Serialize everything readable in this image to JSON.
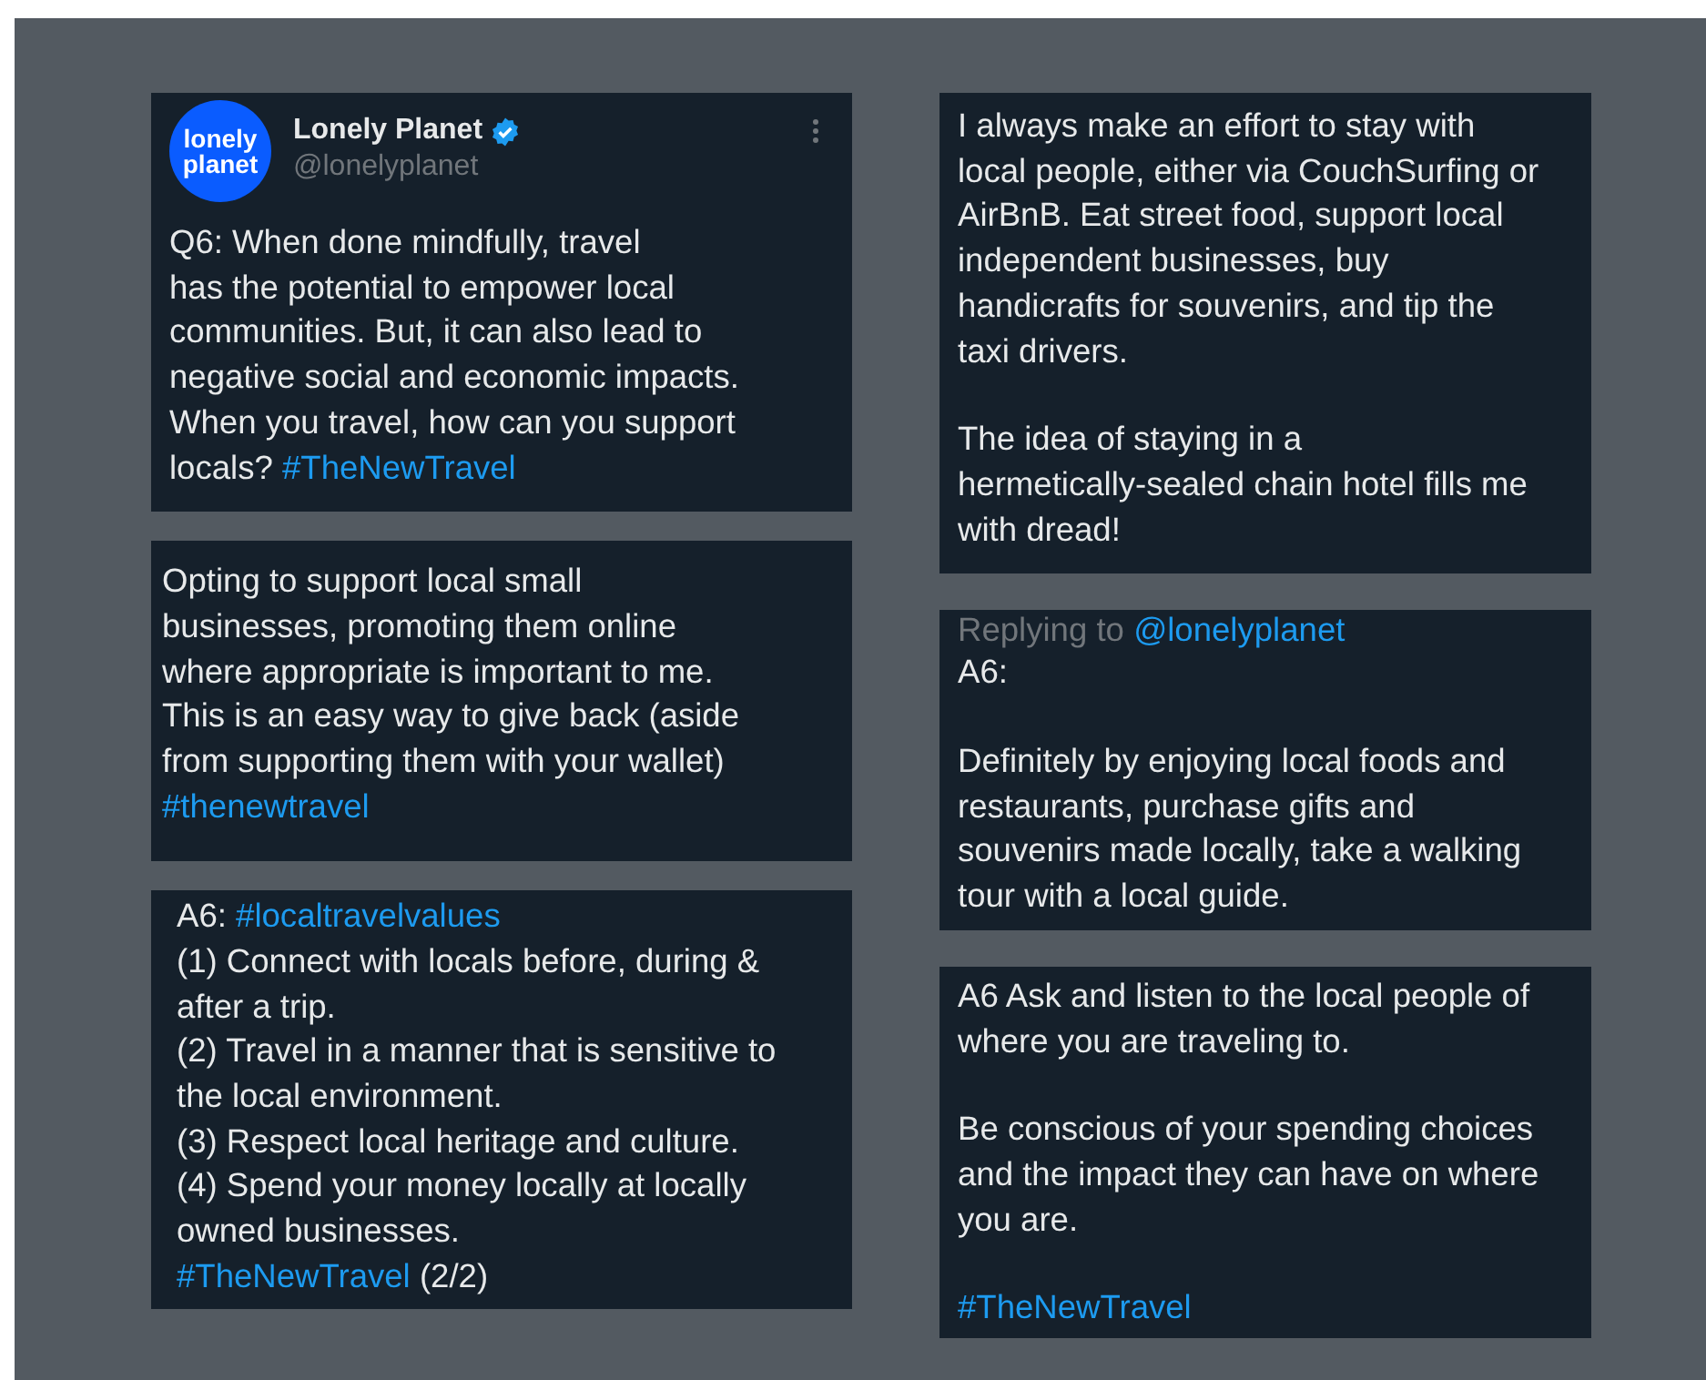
{
  "columns": [
    {
      "posts": [
        {
          "author": {
            "logo_text": "lonely\nplanet",
            "name": "Lonely Planet",
            "verified": true,
            "handle": "@lonelyplanet"
          },
          "paragraphs": [
            [
              {
                "kind": "text",
                "text": "Q6: When done mindfully, travel\nhas the potential to empower local\ncommunities. But, it can also lead to\nnegative social and economic impacts.\nWhen you travel, how can you support\nlocals? "
              },
              {
                "kind": "hashtag",
                "text": "#TheNewTravel"
              }
            ]
          ]
        },
        {
          "paragraphs": [
            [
              {
                "kind": "text",
                "text": "Opting to support local small\nbusinesses, promoting them online\nwhere appropriate is important to me.\nThis is an easy way to give back (aside\nfrom supporting them with your wallet)\n"
              },
              {
                "kind": "hashtag",
                "text": "#thenewtravel"
              }
            ]
          ]
        },
        {
          "paragraphs": [
            [
              {
                "kind": "text",
                "text": "A6: "
              },
              {
                "kind": "hashtag",
                "text": "#localtravelvalues"
              },
              {
                "kind": "text",
                "text": "\n(1) Connect with locals before, during &\nafter a trip.\n(2) Travel in a manner that is sensitive to\nthe local environment.\n(3) Respect local heritage and culture.\n(4) Spend your money locally at locally\nowned businesses.\n "
              },
              {
                "kind": "hashtag",
                "text": "#TheNewTravel"
              },
              {
                "kind": "text",
                "text": " (2/2)"
              }
            ]
          ]
        }
      ]
    },
    {
      "posts": [
        {
          "paragraphs": [
            [
              {
                "kind": "text",
                "text": "I always make an effort to stay with\nlocal people, either via CouchSurfing or\nAirBnB. Eat street food, support local\nindependent businesses, buy\nhandicrafts for souvenirs, and tip the\ntaxi drivers."
              }
            ],
            [
              {
                "kind": "text",
                "text": "The idea of staying in a\nhermetically-sealed chain hotel fills me\nwith dread!"
              }
            ]
          ]
        },
        {
          "reply_to": {
            "label": "Replying to",
            "handle": "@lonelyplanet"
          },
          "paragraphs": [
            [
              {
                "kind": "text",
                "text": "A6:"
              }
            ],
            [
              {
                "kind": "text",
                "text": "Definitely by enjoying local foods and\nrestaurants, purchase gifts and\nsouvenirs made locally, take a walking\ntour with a local guide."
              }
            ]
          ]
        },
        {
          "paragraphs": [
            [
              {
                "kind": "text",
                "text": "A6 Ask and listen to the local people of\nwhere you are traveling to."
              }
            ],
            [
              {
                "kind": "text",
                "text": "Be conscious of your spending choices\nand the impact they can have on where\nyou are."
              }
            ],
            [
              {
                "kind": "hashtag",
                "text": "#TheNewTravel"
              }
            ]
          ]
        }
      ]
    }
  ]
}
